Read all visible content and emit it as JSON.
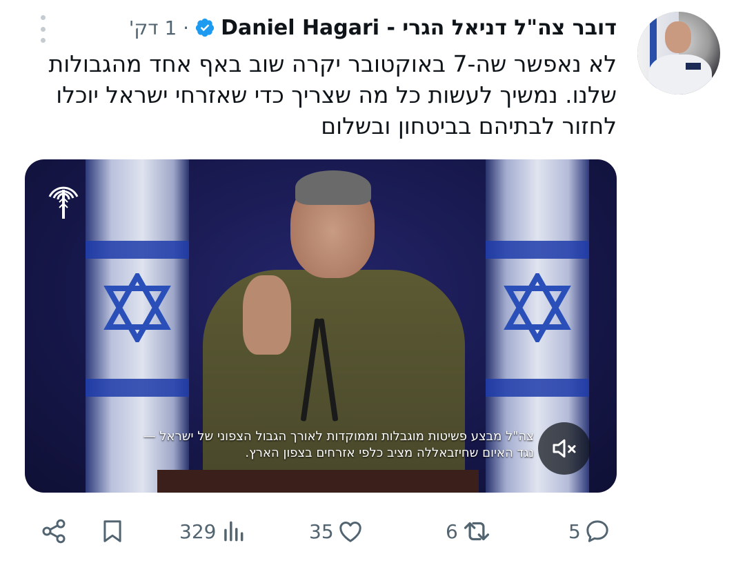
{
  "tweet": {
    "display_name": "דובר צה\"ל דניאל הגרי - Daniel Hagari",
    "timestamp": "· 1 דק'",
    "text": "לא נאפשר שה-7 באוקטובר יקרה שוב באף אחד מהגבולות שלנו. נמשיך לעשות כל מה שצריך כדי שאזרחי ישראל יוכלו לחזור לבתיהם בביטחון ובשלום"
  },
  "video": {
    "subtitle_line1": "צה\"ל מבצע פשיטות מוגבלות וממוקדות לאורך הגבול הצפוני של ישראל —",
    "subtitle_line2": "נגד האיום שחיזבאללה מציב כלפי אזרחים בצפון הארץ."
  },
  "actions": {
    "replies": "5",
    "reposts": "6",
    "likes": "35",
    "views": "329"
  },
  "icons": {
    "verified": "verified-badge-icon",
    "more": "more-vertical-icon",
    "mute": "mute-icon",
    "share": "share-icon",
    "bookmark": "bookmark-icon",
    "views": "views-chart-icon",
    "like": "heart-icon",
    "repost": "repost-icon",
    "reply": "reply-icon"
  },
  "colors": {
    "accent": "#1d9bf0",
    "text": "#0f1419",
    "muted": "#536471"
  }
}
